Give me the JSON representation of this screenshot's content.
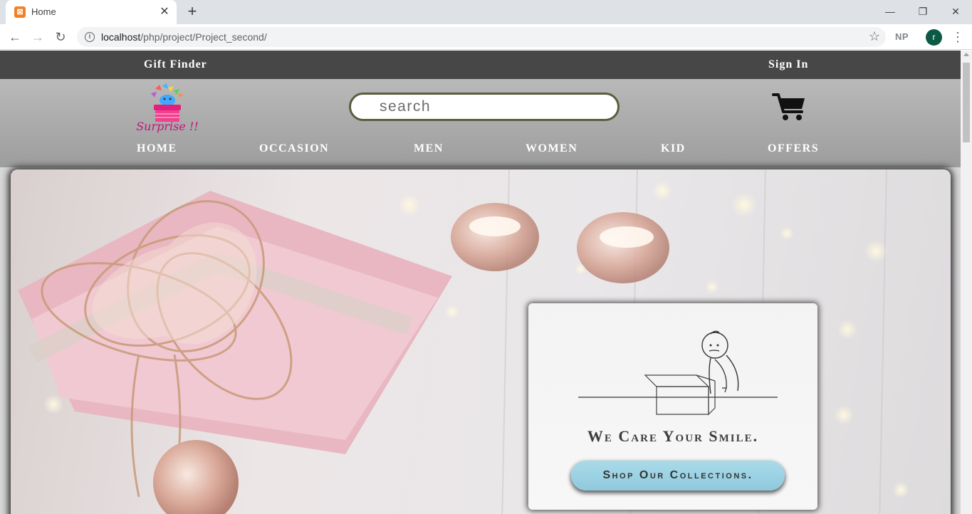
{
  "browser": {
    "tab_title": "Home",
    "favicon_glyph": "⊠",
    "url_host": "localhost",
    "url_path": "/php/project/Project_second/",
    "extension_label": "NP",
    "profile_initial": "r",
    "profile_color": "#0c5a45"
  },
  "topbar": {
    "gift_finder": "Gift Finder",
    "sign_in": "Sign In"
  },
  "header": {
    "logo_text": "Surprise !!",
    "search_placeholder": "search",
    "cart_icon": "shopping-cart-icon"
  },
  "nav": {
    "items": [
      "HOME",
      "OCCASION",
      "MEN",
      "WOMEN",
      "KID",
      "OFFERS"
    ]
  },
  "hero": {
    "tagline": "We Care Your Smile.",
    "cta": "Shop Our Collections.",
    "cta_color": "#a9dbe9"
  },
  "colors": {
    "topbar": "#474747",
    "header": "#a8a8a8",
    "search_border": "#5c5c3d"
  }
}
